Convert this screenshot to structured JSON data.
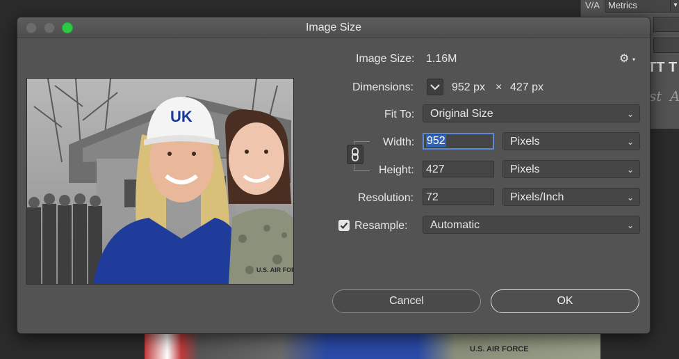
{
  "window": {
    "title": "Image Size"
  },
  "background": {
    "panel_label": "V/A",
    "metrics_value": "Metrics",
    "tt_glyph_1": "TT",
    "tt_glyph_2": "T",
    "glyph_st": "st",
    "glyph_a": "A",
    "photo_label": "U.S. AIR FORCE"
  },
  "info": {
    "image_size_label": "Image Size:",
    "image_size_value": "1.16M",
    "dimensions_label": "Dimensions:",
    "dim_width": "952 px",
    "dim_times": "×",
    "dim_height": "427 px"
  },
  "fit_to": {
    "label": "Fit To:",
    "value": "Original Size"
  },
  "width": {
    "label": "Width:",
    "value": "952",
    "unit": "Pixels"
  },
  "height": {
    "label": "Height:",
    "value": "427",
    "unit": "Pixels"
  },
  "resolution": {
    "label": "Resolution:",
    "value": "72",
    "unit": "Pixels/Inch"
  },
  "resample": {
    "label": "Resample:",
    "checked": true,
    "value": "Automatic"
  },
  "buttons": {
    "cancel": "Cancel",
    "ok": "OK"
  },
  "preview": {
    "cap_text": "UK",
    "uniform_text": "U.S. AIR FORCE"
  },
  "icons": {
    "gear": "gear-icon",
    "chevron": "chevron-down-icon",
    "chain": "chain-link-icon",
    "check": "checkmark-icon"
  },
  "colors": {
    "accent": "#2e63b8",
    "focus_ring": "#5a8ad6",
    "zoom_button": "#2ec845"
  }
}
